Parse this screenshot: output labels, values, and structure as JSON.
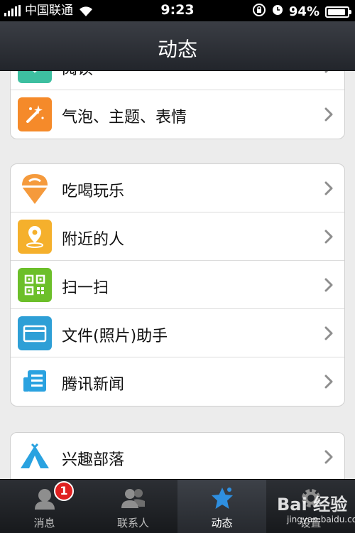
{
  "status_bar": {
    "carrier": "中国联通",
    "time": "9:23",
    "battery_percent": "94%",
    "battery_level": 0.94,
    "icons": [
      "signal-bars-icon",
      "wifi-icon",
      "rotation-lock-icon",
      "alarm-icon",
      "battery-icon"
    ]
  },
  "nav": {
    "title": "动态"
  },
  "groups": [
    {
      "items": [
        {
          "label": "阅读",
          "icon": "reading-icon",
          "color": "#3dbfa0"
        },
        {
          "label": "气泡、主题、表情",
          "icon": "magic-wand-icon",
          "color": "#f58a2a"
        }
      ]
    },
    {
      "items": [
        {
          "label": "吃喝玩乐",
          "icon": "ice-cream-icon",
          "color": "#f59a3c"
        },
        {
          "label": "附近的人",
          "icon": "location-pin-icon",
          "color": "#f5b02c"
        },
        {
          "label": "扫一扫",
          "icon": "qr-code-icon",
          "color": "#6cbf2a"
        },
        {
          "label": "文件(照片)助手",
          "icon": "folder-icon",
          "color": "#2e9fd6"
        },
        {
          "label": "腾讯新闻",
          "icon": "news-icon",
          "color": "#2aa2e0"
        }
      ]
    },
    {
      "items": [
        {
          "label": "兴趣部落",
          "icon": "tribe-tent-icon",
          "color": "#2aa2e0"
        }
      ]
    }
  ],
  "tabs": [
    {
      "label": "消息",
      "icon": "chat-bubble-icon",
      "badge": "1"
    },
    {
      "label": "联系人",
      "icon": "contacts-icon"
    },
    {
      "label": "动态",
      "icon": "star-icon",
      "active": true
    },
    {
      "label": "设置",
      "icon": "gear-icon"
    }
  ],
  "watermark": {
    "main": "Bai 经验",
    "sub": "jingyan.baidu.com"
  },
  "colors": {
    "nav_bar": "#2b2e34",
    "background": "#ececec",
    "tab_bar": "#1d1f23",
    "badge": "#e02020",
    "chevron": "#8e8e8e"
  }
}
